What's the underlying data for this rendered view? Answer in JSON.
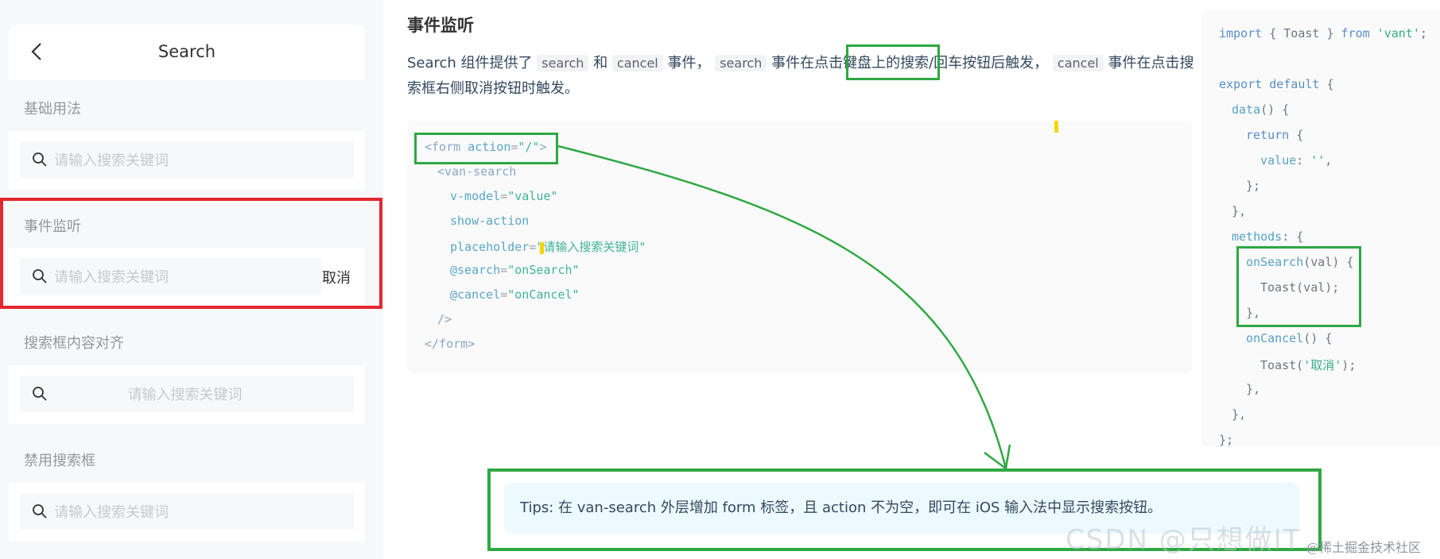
{
  "demo": {
    "nav_title": "Search",
    "sections": [
      {
        "title": "基础用法",
        "placeholder": "请输入搜索关键词"
      },
      {
        "title": "事件监听",
        "placeholder": "请输入搜索关键词",
        "cancel": "取消"
      },
      {
        "title": "搜索框内容对齐",
        "placeholder": "请输入搜索关键词"
      },
      {
        "title": "禁用搜索框",
        "placeholder": "请输入搜索关键词"
      }
    ]
  },
  "doc": {
    "heading": "事件监听",
    "para": {
      "p1": "Search 组件提供了",
      "code1": "search",
      "p2": "和",
      "code2": "cancel",
      "p3": "事件，",
      "code3": "search",
      "p4": "事件在点击键盘上的搜索/回车按钮后触发，",
      "code4": "cancel",
      "p5": "事件在点击搜索框右侧取消按钮时触发。"
    },
    "template_code": {
      "l1_open": "<form",
      "l1_attr": " action",
      "l1_eq": "=",
      "l1_val": "\"/\"",
      "l1_close": ">",
      "l2": "<van-search",
      "l3_attr": "v-model",
      "l3_val": "\"value\"",
      "l4_attr": "show-action",
      "l5_attr": "placeholder",
      "l5_val": "\"请输入搜索关键词\"",
      "l6_attr": "@search",
      "l6_val": "\"onSearch\"",
      "l7_attr": "@cancel",
      "l7_val": "\"onCancel\"",
      "l8": "/>",
      "l9": "</form>"
    },
    "script_code": {
      "l1_kw": "import",
      "l1_mid": " { Toast } ",
      "l1_from": "from",
      "l1_str": " 'vant'",
      "l1_end": ";",
      "l2_kw": "export default",
      "l2_end": " {",
      "l3_fn": "data",
      "l3_end": "() {",
      "l4_kw": "return",
      "l4_end": " {",
      "l5_key": "value",
      "l5_mid": ": ",
      "l5_str": "''",
      "l5_end": ",",
      "l6": "};",
      "l7": "},",
      "l8_key": "methods",
      "l8_end": ": {",
      "l9_fn": "onSearch",
      "l9_end": "(val) {",
      "l10_fn": "Toast",
      "l10_end": "(val);",
      "l11": "},",
      "l12_fn": "onCancel",
      "l12_end": "() {",
      "l13_fn": "Toast",
      "l13_open": "(",
      "l13_str": "'取消'",
      "l13_end": ");",
      "l14": "},",
      "l15": "},",
      "l16": "};"
    },
    "tip": {
      "t1": "Tips: 在 van-search 外层增加 form 标签，且 action 不为空，即可在 iOS 输入法中显示搜索按钮。"
    }
  },
  "watermark": "CSDN @只想做IT",
  "watermark_site": "@稀土掘金技术社区",
  "colors": {
    "annotation_green": "#2ea843",
    "annotation_red": "#e5282e"
  }
}
